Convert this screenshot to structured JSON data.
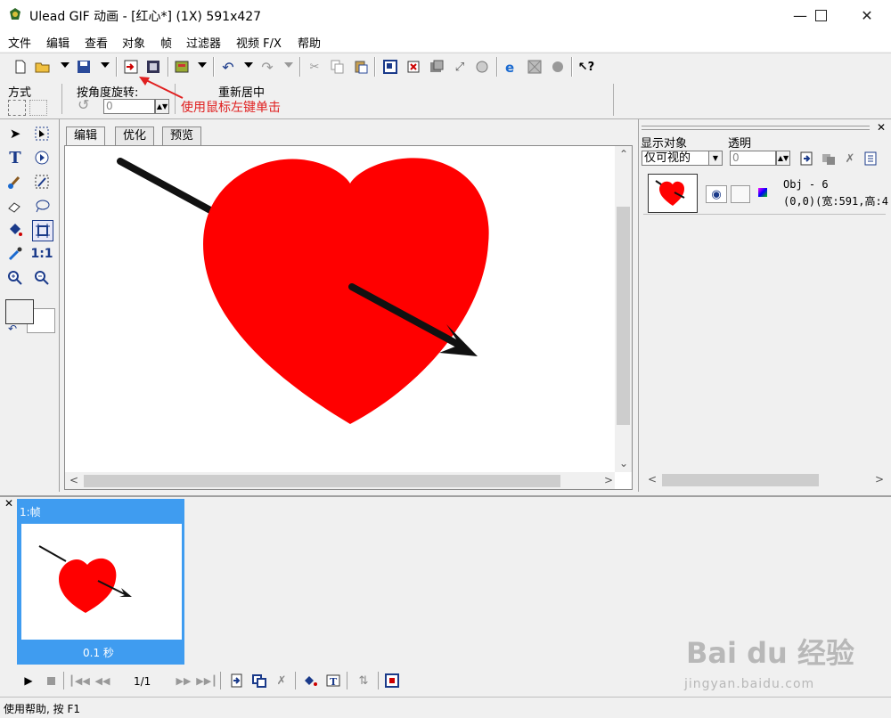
{
  "window": {
    "title": "Ulead GIF 动画 - [红心*] (1X) 591x427",
    "minimize_icon": "minimize-icon",
    "maximize_icon": "maximize-icon",
    "close_icon": "close-icon"
  },
  "menu": [
    "文件",
    "编辑",
    "查看",
    "对象",
    "帧",
    "过滤器",
    "视频 F/X",
    "帮助"
  ],
  "properties": {
    "mode_label": "方式",
    "rotate_label": "按角度旋转:",
    "rotate_value": "0",
    "recenter_label": "重新居中"
  },
  "annotation": {
    "text": "使用鼠标左键单击",
    "color": "#e02020"
  },
  "canvas_tabs": [
    "编辑",
    "优化",
    "预览"
  ],
  "object_panel": {
    "show_label": "显示对象",
    "transparency_label": "透明",
    "show_select_value": "仅可视的",
    "transparency_value": "0",
    "object_name": "Obj - 6",
    "object_info": "(0,0)(宽:591,高:4"
  },
  "frames": {
    "frame_label": "1:帧",
    "frame_delay": "0.1 秒",
    "counter": "1/1"
  },
  "status": {
    "text": "使用帮助, 按 F1"
  },
  "colors": {
    "heart": "#ff0000",
    "frame_selected": "#3f9cf0",
    "watermark": "#b8b8b8"
  },
  "watermark": {
    "brand": "Bai du 经验",
    "url": "jingyan.baidu.com"
  }
}
